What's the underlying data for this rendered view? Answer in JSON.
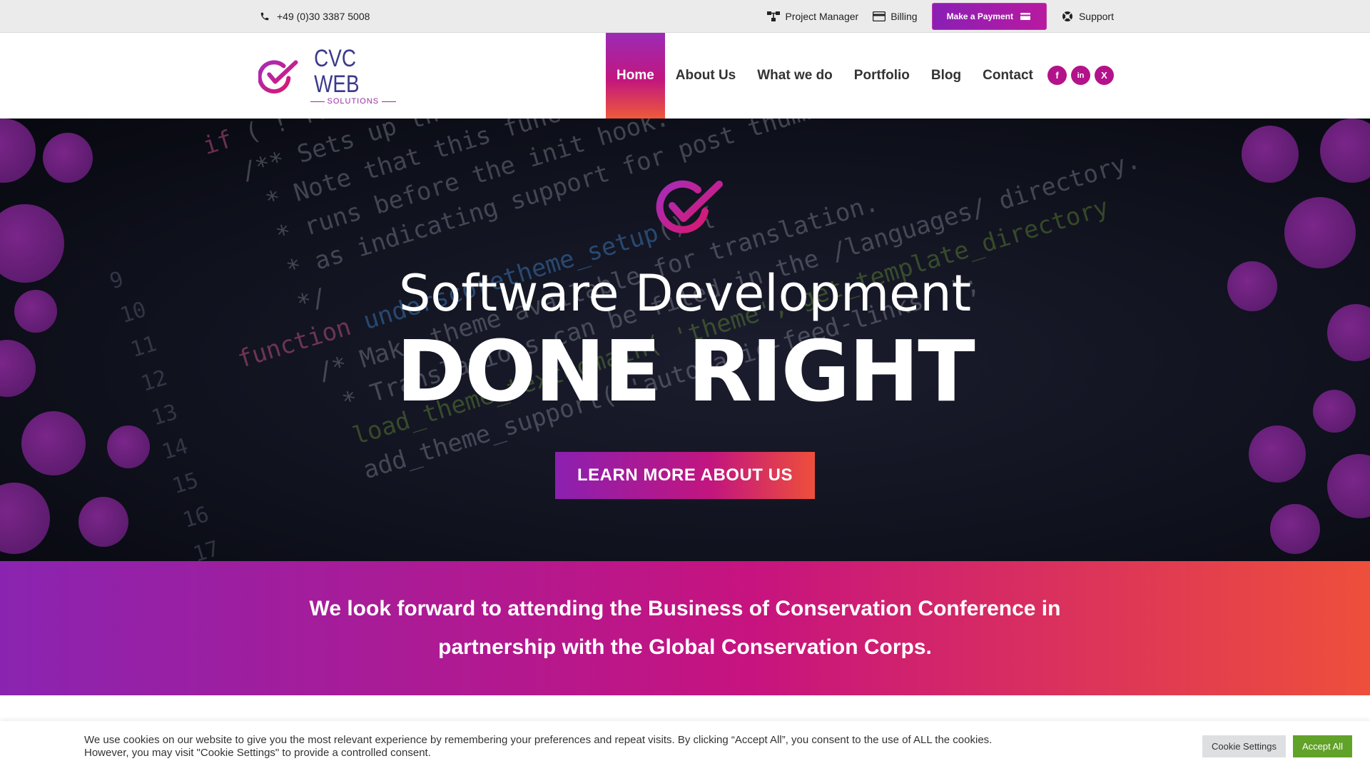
{
  "topbar": {
    "phone": "+49 (0)30 3387 5008",
    "links": {
      "project_manager": "Project Manager",
      "billing": "Billing",
      "payment": "Make a Payment",
      "support": "Support"
    }
  },
  "header": {
    "logo": {
      "main": "CVC WEB",
      "sub": "SOLUTIONS"
    },
    "nav": [
      "Home",
      "About Us",
      "What we do",
      "Portfolio",
      "Blog",
      "Contact"
    ],
    "active_nav": "Home",
    "social": [
      {
        "icon": "facebook-icon",
        "glyph": "f",
        "color": "#b3128a"
      },
      {
        "icon": "linkedin-icon",
        "glyph": "in",
        "color": "#b3128a"
      },
      {
        "icon": "x-icon",
        "glyph": "X",
        "color": "#b3128a"
      }
    ]
  },
  "hero": {
    "title_line1": "Software Development",
    "title_line2": "DONE RIGHT",
    "button": "LEARN MORE ABOUT US"
  },
  "banner": {
    "text": "We look forward to attending the Business of Conservation Conference in partnership with the Global Conservation Corps."
  },
  "cookie": {
    "text": "We use cookies on our website to give you the most relevant experience by remembering your preferences and repeat visits. By clicking “Accept All”, you consent to the use of ALL the cookies. However, you may visit \"Cookie Settings\" to provide a controlled consent.",
    "settings": "Cookie Settings",
    "accept": "Accept All"
  },
  "colors": {
    "brand_purple": "#8a24b0",
    "brand_magenta": "#c7137f",
    "brand_orange": "#ee4f3b",
    "accept_green": "#61a229"
  }
}
